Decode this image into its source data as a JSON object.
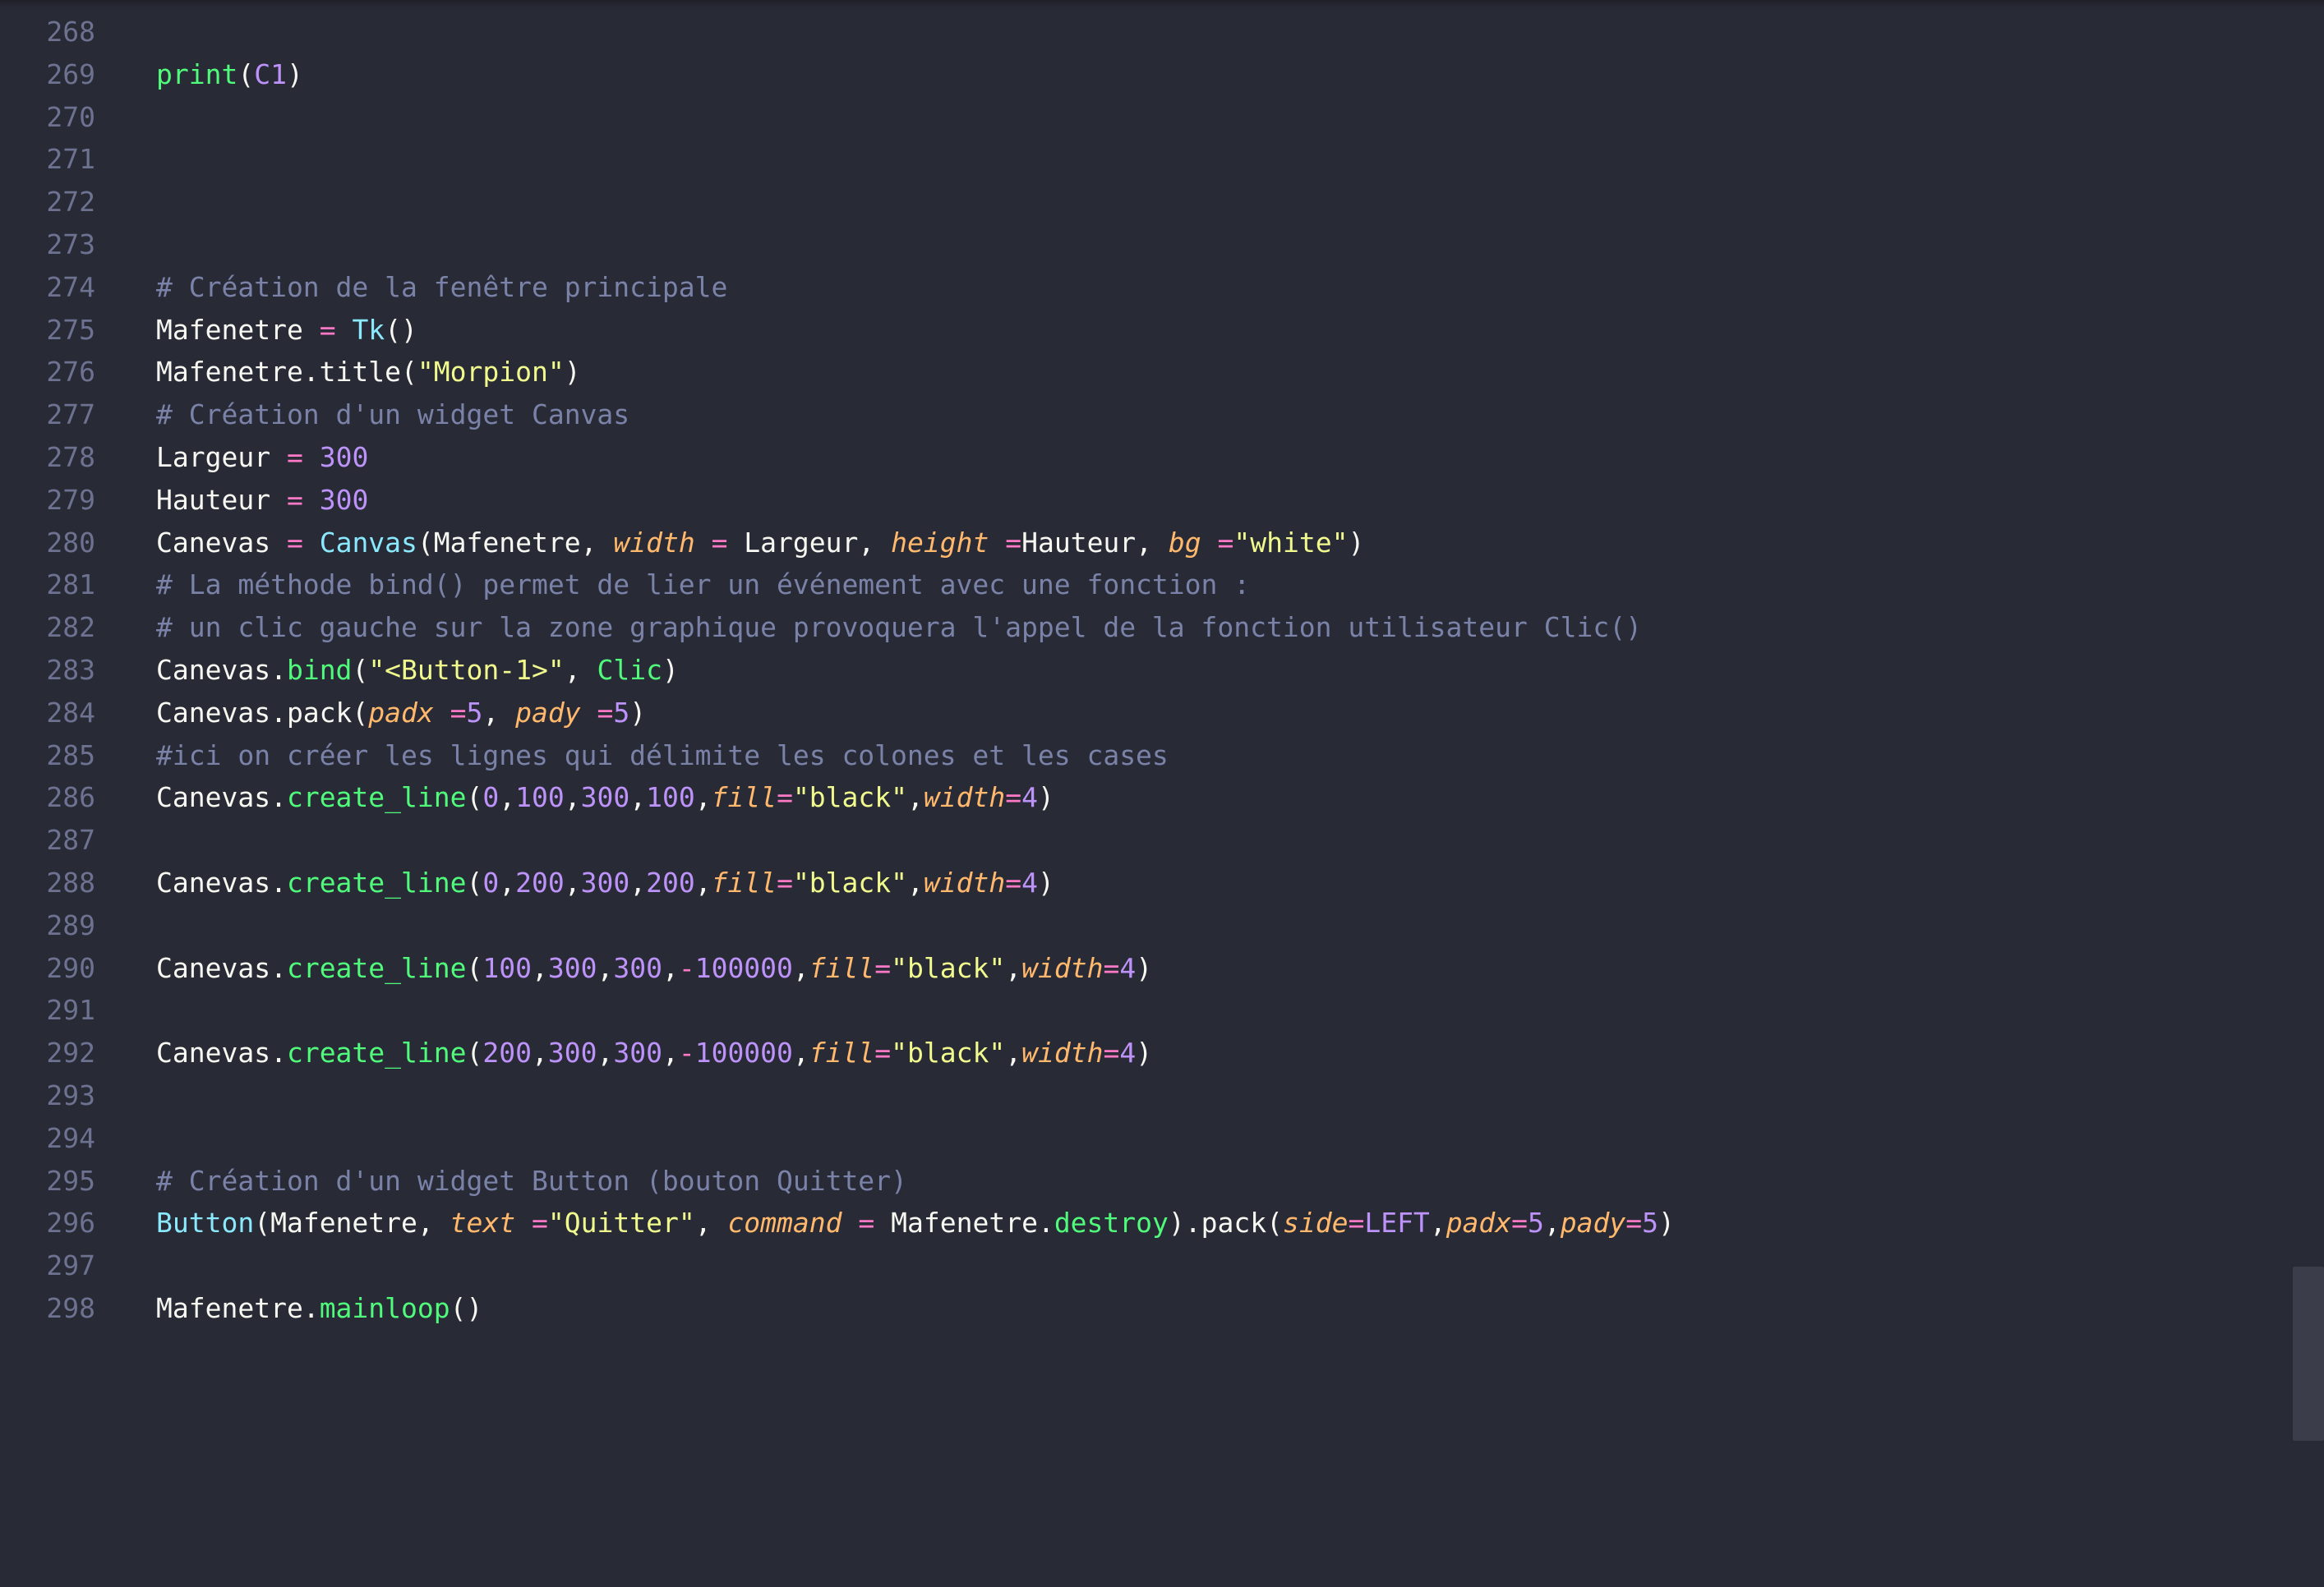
{
  "editor": {
    "theme_colors": {
      "background": "#282a36",
      "gutter_text": "#6d7290",
      "comment": "#7a82a8",
      "keyword": "#ff79c6",
      "function": "#50fa7b",
      "class": "#8be9fd",
      "string": "#f1fa8c",
      "number": "#bd93f9",
      "parameter": "#ffb86c",
      "plain": "#f8f8f2"
    },
    "lines": [
      {
        "num": "268",
        "tokens": []
      },
      {
        "num": "269",
        "tokens": [
          [
            "fn",
            "print"
          ],
          [
            "plain",
            "("
          ],
          [
            "const",
            "C1"
          ],
          [
            "plain",
            ")"
          ]
        ]
      },
      {
        "num": "270",
        "tokens": []
      },
      {
        "num": "271",
        "tokens": []
      },
      {
        "num": "272",
        "tokens": []
      },
      {
        "num": "273",
        "tokens": []
      },
      {
        "num": "274",
        "tokens": [
          [
            "comment",
            "# Création de la fenêtre principale"
          ]
        ]
      },
      {
        "num": "275",
        "tokens": [
          [
            "plain",
            "Mafenetre "
          ],
          [
            "kw",
            "="
          ],
          [
            "plain",
            " "
          ],
          [
            "cls",
            "Tk"
          ],
          [
            "plain",
            "()"
          ]
        ]
      },
      {
        "num": "276",
        "tokens": [
          [
            "plain",
            "Mafenetre.title("
          ],
          [
            "str",
            "\"Morpion\""
          ],
          [
            "plain",
            ")"
          ]
        ]
      },
      {
        "num": "277",
        "tokens": [
          [
            "comment",
            "# Création d'un widget Canvas"
          ]
        ]
      },
      {
        "num": "278",
        "tokens": [
          [
            "plain",
            "Largeur "
          ],
          [
            "kw",
            "="
          ],
          [
            "plain",
            " "
          ],
          [
            "num",
            "300"
          ]
        ]
      },
      {
        "num": "279",
        "tokens": [
          [
            "plain",
            "Hauteur "
          ],
          [
            "kw",
            "="
          ],
          [
            "plain",
            " "
          ],
          [
            "num",
            "300"
          ]
        ]
      },
      {
        "num": "280",
        "tokens": [
          [
            "plain",
            "Canevas "
          ],
          [
            "kw",
            "="
          ],
          [
            "plain",
            " "
          ],
          [
            "cls",
            "Canvas"
          ],
          [
            "plain",
            "(Mafenetre, "
          ],
          [
            "param",
            "width"
          ],
          [
            "plain",
            " "
          ],
          [
            "kw",
            "="
          ],
          [
            "plain",
            " Largeur, "
          ],
          [
            "param",
            "height"
          ],
          [
            "plain",
            " "
          ],
          [
            "kw",
            "="
          ],
          [
            "plain",
            "Hauteur, "
          ],
          [
            "param",
            "bg"
          ],
          [
            "plain",
            " "
          ],
          [
            "kw",
            "="
          ],
          [
            "str",
            "\"white\""
          ],
          [
            "plain",
            ")"
          ]
        ]
      },
      {
        "num": "281",
        "tokens": [
          [
            "comment",
            "# La méthode bind() permet de lier un événement avec une fonction :"
          ]
        ]
      },
      {
        "num": "282",
        "tokens": [
          [
            "comment",
            "# un clic gauche sur la zone graphique provoquera l'appel de la fonction utilisateur Clic()"
          ]
        ]
      },
      {
        "num": "283",
        "tokens": [
          [
            "plain",
            "Canevas."
          ],
          [
            "fn",
            "bind"
          ],
          [
            "plain",
            "("
          ],
          [
            "str",
            "\"<Button-1>\""
          ],
          [
            "plain",
            ", "
          ],
          [
            "fn",
            "Clic"
          ],
          [
            "plain",
            ")"
          ]
        ]
      },
      {
        "num": "284",
        "tokens": [
          [
            "plain",
            "Canevas.pack("
          ],
          [
            "param",
            "padx"
          ],
          [
            "plain",
            " "
          ],
          [
            "kw",
            "="
          ],
          [
            "num",
            "5"
          ],
          [
            "plain",
            ", "
          ],
          [
            "param",
            "pady"
          ],
          [
            "plain",
            " "
          ],
          [
            "kw",
            "="
          ],
          [
            "num",
            "5"
          ],
          [
            "plain",
            ")"
          ]
        ]
      },
      {
        "num": "285",
        "tokens": [
          [
            "comment",
            "#ici on créer les lignes qui délimite les colones et les cases"
          ]
        ]
      },
      {
        "num": "286",
        "tokens": [
          [
            "plain",
            "Canevas."
          ],
          [
            "fn",
            "create_line"
          ],
          [
            "plain",
            "("
          ],
          [
            "num",
            "0"
          ],
          [
            "plain",
            ","
          ],
          [
            "num",
            "100"
          ],
          [
            "plain",
            ","
          ],
          [
            "num",
            "300"
          ],
          [
            "plain",
            ","
          ],
          [
            "num",
            "100"
          ],
          [
            "plain",
            ","
          ],
          [
            "param",
            "fill"
          ],
          [
            "kw",
            "="
          ],
          [
            "str",
            "\"black\""
          ],
          [
            "plain",
            ","
          ],
          [
            "param",
            "width"
          ],
          [
            "kw",
            "="
          ],
          [
            "num",
            "4"
          ],
          [
            "plain",
            ")"
          ]
        ]
      },
      {
        "num": "287",
        "tokens": []
      },
      {
        "num": "288",
        "tokens": [
          [
            "plain",
            "Canevas."
          ],
          [
            "fn",
            "create_line"
          ],
          [
            "plain",
            "("
          ],
          [
            "num",
            "0"
          ],
          [
            "plain",
            ","
          ],
          [
            "num",
            "200"
          ],
          [
            "plain",
            ","
          ],
          [
            "num",
            "300"
          ],
          [
            "plain",
            ","
          ],
          [
            "num",
            "200"
          ],
          [
            "plain",
            ","
          ],
          [
            "param",
            "fill"
          ],
          [
            "kw",
            "="
          ],
          [
            "str",
            "\"black\""
          ],
          [
            "plain",
            ","
          ],
          [
            "param",
            "width"
          ],
          [
            "kw",
            "="
          ],
          [
            "num",
            "4"
          ],
          [
            "plain",
            ")"
          ]
        ]
      },
      {
        "num": "289",
        "tokens": []
      },
      {
        "num": "290",
        "tokens": [
          [
            "plain",
            "Canevas."
          ],
          [
            "fn",
            "create_line"
          ],
          [
            "plain",
            "("
          ],
          [
            "num",
            "100"
          ],
          [
            "plain",
            ","
          ],
          [
            "num",
            "300"
          ],
          [
            "plain",
            ","
          ],
          [
            "num",
            "300"
          ],
          [
            "plain",
            ","
          ],
          [
            "kw",
            "-"
          ],
          [
            "num",
            "100000"
          ],
          [
            "plain",
            ","
          ],
          [
            "param",
            "fill"
          ],
          [
            "kw",
            "="
          ],
          [
            "str",
            "\"black\""
          ],
          [
            "plain",
            ","
          ],
          [
            "param",
            "width"
          ],
          [
            "kw",
            "="
          ],
          [
            "num",
            "4"
          ],
          [
            "plain",
            ")"
          ]
        ]
      },
      {
        "num": "291",
        "tokens": []
      },
      {
        "num": "292",
        "tokens": [
          [
            "plain",
            "Canevas."
          ],
          [
            "fn",
            "create_line"
          ],
          [
            "plain",
            "("
          ],
          [
            "num",
            "200"
          ],
          [
            "plain",
            ","
          ],
          [
            "num",
            "300"
          ],
          [
            "plain",
            ","
          ],
          [
            "num",
            "300"
          ],
          [
            "plain",
            ","
          ],
          [
            "kw",
            "-"
          ],
          [
            "num",
            "100000"
          ],
          [
            "plain",
            ","
          ],
          [
            "param",
            "fill"
          ],
          [
            "kw",
            "="
          ],
          [
            "str",
            "\"black\""
          ],
          [
            "plain",
            ","
          ],
          [
            "param",
            "width"
          ],
          [
            "kw",
            "="
          ],
          [
            "num",
            "4"
          ],
          [
            "plain",
            ")"
          ]
        ]
      },
      {
        "num": "293",
        "tokens": []
      },
      {
        "num": "294",
        "tokens": []
      },
      {
        "num": "295",
        "tokens": [
          [
            "comment",
            "# Création d'un widget Button (bouton Quitter)"
          ]
        ]
      },
      {
        "num": "296",
        "tokens": [
          [
            "cls",
            "Button"
          ],
          [
            "plain",
            "(Mafenetre, "
          ],
          [
            "param",
            "text"
          ],
          [
            "plain",
            " "
          ],
          [
            "kw",
            "="
          ],
          [
            "str",
            "\"Quitter\""
          ],
          [
            "plain",
            ", "
          ],
          [
            "param",
            "command"
          ],
          [
            "plain",
            " "
          ],
          [
            "kw",
            "="
          ],
          [
            "plain",
            " Mafenetre."
          ],
          [
            "fn",
            "destroy"
          ],
          [
            "plain",
            ").pack("
          ],
          [
            "param",
            "side"
          ],
          [
            "kw",
            "="
          ],
          [
            "const",
            "LEFT"
          ],
          [
            "plain",
            ","
          ],
          [
            "param",
            "padx"
          ],
          [
            "kw",
            "="
          ],
          [
            "num",
            "5"
          ],
          [
            "plain",
            ","
          ],
          [
            "param",
            "pady"
          ],
          [
            "kw",
            "="
          ],
          [
            "num",
            "5"
          ],
          [
            "plain",
            ")"
          ]
        ]
      },
      {
        "num": "297",
        "tokens": []
      },
      {
        "num": "298",
        "tokens": [
          [
            "plain",
            "Mafenetre."
          ],
          [
            "fn",
            "mainloop"
          ],
          [
            "plain",
            "()"
          ]
        ]
      }
    ]
  }
}
